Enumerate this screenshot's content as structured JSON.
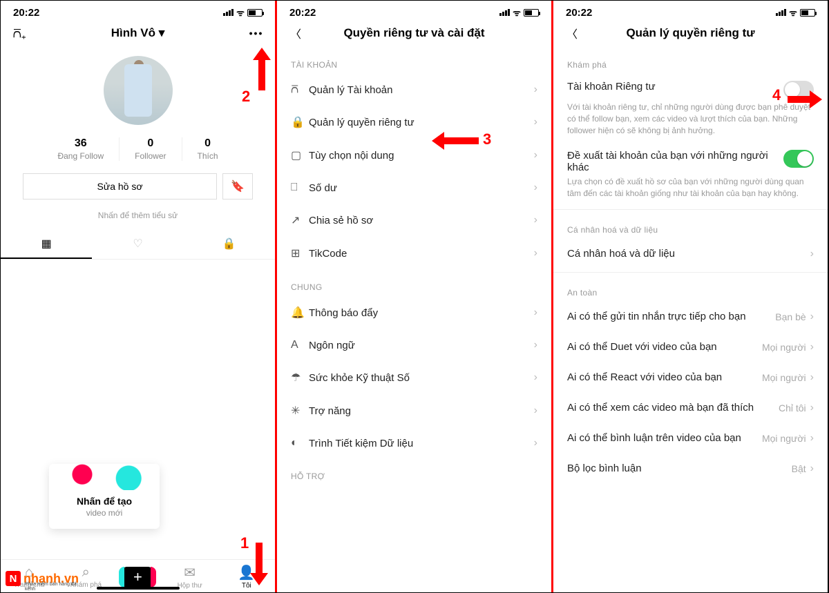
{
  "status": {
    "time": "20:22"
  },
  "panel1": {
    "username": "Hình Vô",
    "stats": {
      "following_num": "36",
      "following_lbl": "Đang Follow",
      "followers_num": "0",
      "followers_lbl": "Follower",
      "likes_num": "0",
      "likes_lbl": "Thích"
    },
    "edit_btn": "Sửa hồ sơ",
    "bio_hint": "Nhấn để thêm tiểu sử",
    "create": {
      "l1": "Nhấn để tạo",
      "l2": "video mới"
    },
    "nav": {
      "home": "Trang chủ",
      "discover": "Khám phá",
      "inbox": "Hộp thư",
      "me": "Tôi"
    }
  },
  "panel2": {
    "title": "Quyền riêng tư và cài đặt",
    "sect_account": "TÀI KHOẢN",
    "account_items": [
      "Quản lý Tài khoản",
      "Quản lý quyền riêng tư",
      "Tùy chọn nội dung",
      "Số dư",
      "Chia sẻ hồ sơ",
      "TikCode"
    ],
    "sect_general": "CHUNG",
    "general_items": [
      "Thông báo đẩy",
      "Ngôn ngữ",
      "Sức khỏe Kỹ thuật Số",
      "Trợ năng",
      "Trình Tiết kiệm Dữ liệu"
    ],
    "sect_support": "HỖ TRỢ"
  },
  "panel3": {
    "title": "Quản lý quyền riêng tư",
    "sect_discover": "Khám phá",
    "private_title": "Tài khoản Riêng tư",
    "private_desc": "Với tài khoản riêng tư, chỉ những người dùng được bạn phê duyệt có thể follow bạn, xem các video và lượt thích của bạn. Những follower hiện có sẽ không bị ảnh hưởng.",
    "suggest_title": "Đề xuất tài khoản của bạn với những người khác",
    "suggest_desc": "Lựa chọn có đề xuất hồ sơ của bạn với những người dùng quan tâm đến các tài khoản giống như tài khoản của bạn hay không.",
    "sect_personal": "Cá nhân hoá và dữ liệu",
    "personal_row": "Cá nhân hoá và dữ liệu",
    "sect_safety": "An toàn",
    "safety": [
      {
        "t": "Ai có thể gửi tin nhắn trực tiếp cho bạn",
        "v": "Bạn bè"
      },
      {
        "t": "Ai có thể Duet với video của bạn",
        "v": "Mọi người"
      },
      {
        "t": "Ai có thể React với video của bạn",
        "v": "Mọi người"
      },
      {
        "t": "Ai có thể xem các video mà bạn đã thích",
        "v": "Chỉ tôi"
      },
      {
        "t": "Ai có thể bình luận trên video của bạn",
        "v": "Mọi người"
      },
      {
        "t": "Bộ lọc bình luận",
        "v": "Bật"
      }
    ]
  },
  "annotations": {
    "a1": "1",
    "a2": "2",
    "a3": "3",
    "a4": "4"
  },
  "brand": {
    "name_a": "nhanh",
    "name_b": ".vn",
    "sub": "Phần mềm bán hàng đa kênh"
  }
}
